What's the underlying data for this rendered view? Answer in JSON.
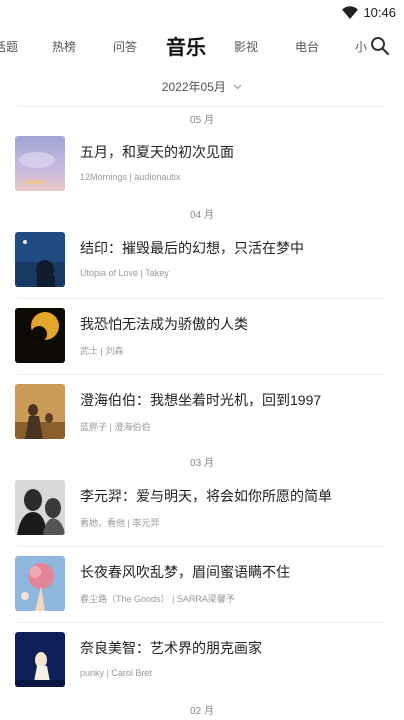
{
  "status_bar": {
    "time": "10:46"
  },
  "tabs": [
    {
      "label": "话题"
    },
    {
      "label": "热榜"
    },
    {
      "label": "问答"
    },
    {
      "label": "音乐",
      "active": true
    },
    {
      "label": "影视"
    },
    {
      "label": "电台"
    },
    {
      "label": "小"
    }
  ],
  "month_picker": {
    "label": "2022年05月"
  },
  "sections": [
    {
      "label": "05 月"
    },
    {
      "label": "04 月"
    },
    {
      "label": "03 月"
    },
    {
      "label": "02 月"
    }
  ],
  "items": [
    {
      "title": "五月，和夏天的初次见面",
      "meta": "12Mornings | audionautix"
    },
    {
      "title": "结印：摧毁最后的幻想，只活在梦中",
      "meta": "Utopia of Love | Takey"
    },
    {
      "title": "我恐怕无法成为骄傲的人类",
      "meta": "武士 | 刘森"
    },
    {
      "title": "澄海伯伯：我想坐着时光机，回到1997",
      "meta": "蓝胖子 | 澄海伯伯"
    },
    {
      "title": "李元羿：爱与明天，将会如你所愿的简单",
      "meta": "看她，看他 | 李元羿"
    },
    {
      "title": "长夜春风吹乱梦，眉间蜜语瞒不住",
      "meta": "春尘路（The Goods） | SARRA梁馨予"
    },
    {
      "title": "奈良美智：艺术界的朋克画家",
      "meta": "punky | Carol Bret"
    }
  ]
}
